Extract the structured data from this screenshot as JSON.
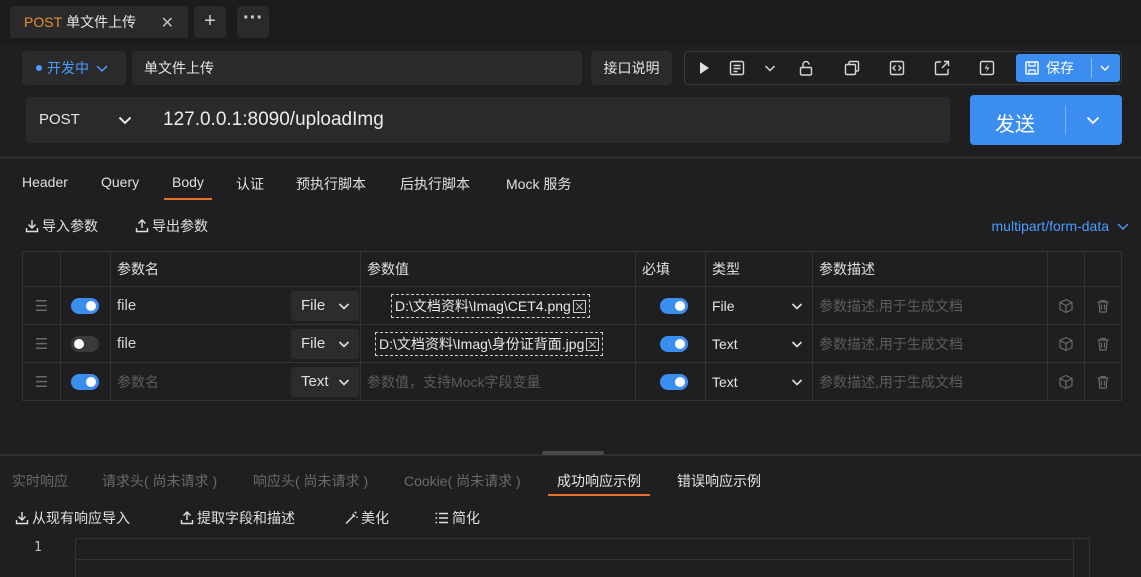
{
  "request_tab": {
    "method": "POST",
    "name": "单文件上传"
  },
  "environment": {
    "label": "开发中"
  },
  "api_name": "单文件上传",
  "doc_button": "接口说明",
  "save_button": "保存",
  "method": "POST",
  "url": "127.0.0.1:8090/uploadImg",
  "send_button": "发送",
  "param_tabs": [
    "Header",
    "Query",
    "Body",
    "认证",
    "预执行脚本",
    "后执行脚本",
    "Mock 服务"
  ],
  "active_param_tab": "Body",
  "actions": {
    "import": "导入参数",
    "export": "导出参数"
  },
  "content_type": "multipart/form-data",
  "table": {
    "headers": {
      "name": "参数名",
      "value": "参数值",
      "required": "必填",
      "type": "类型",
      "desc": "参数描述"
    },
    "rows": [
      {
        "enabled": true,
        "name": "file",
        "kind": "File",
        "value": "D:\\文档资料\\Imag\\CET4.png",
        "required": true,
        "type": "File",
        "desc": "参数描述,用于生成文档"
      },
      {
        "enabled": false,
        "name": "file",
        "kind": "File",
        "value": "D:\\文档资料\\Imag\\身份证背面.jpg",
        "required": true,
        "type": "Text",
        "desc": "参数描述,用于生成文档"
      },
      {
        "enabled": true,
        "name": "参数名",
        "kind": "Text",
        "value": "参数值，支持Mock字段变量",
        "required": true,
        "type": "Text",
        "desc": "参数描述,用于生成文档"
      }
    ]
  },
  "response_tabs": [
    "实时响应",
    "请求头( 尚未请求 )",
    "响应头( 尚未请求 )",
    "Cookie( 尚未请求 )",
    "成功响应示例",
    "错误响应示例"
  ],
  "active_response_tab": "成功响应示例",
  "response_actions": {
    "import": "从现有响应导入",
    "extract": "提取字段和描述",
    "beautify": "美化",
    "simplify": "简化"
  },
  "editor": {
    "line_number": "1"
  },
  "colors": {
    "accent": "#3b8ef0",
    "tab_underline": "#e8712d",
    "method": "#e8912d",
    "link": "#4b9cff"
  }
}
